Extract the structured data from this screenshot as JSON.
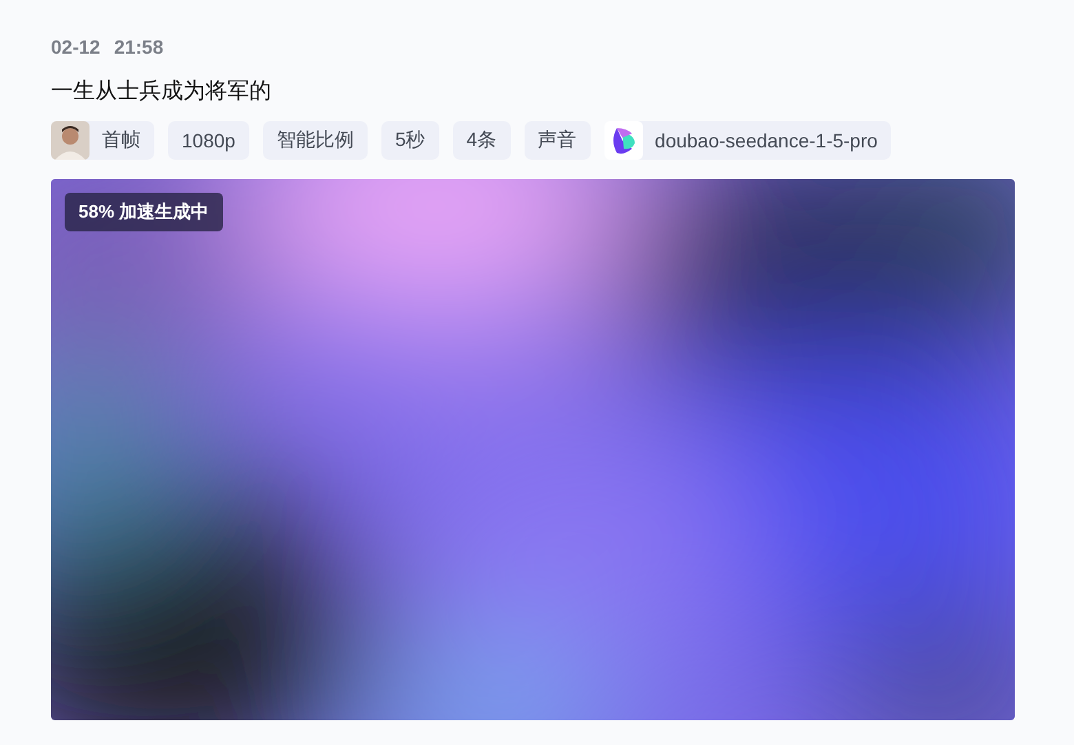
{
  "date": "02-12",
  "time": "21:58",
  "prompt": "一生从士兵成为将军的",
  "tags": [
    {
      "kind": "avatar",
      "label": "首帧"
    },
    {
      "kind": "plain",
      "label": "1080p"
    },
    {
      "kind": "plain",
      "label": "智能比例"
    },
    {
      "kind": "plain",
      "label": "5秒"
    },
    {
      "kind": "plain",
      "label": "4条"
    },
    {
      "kind": "plain",
      "label": "声音"
    },
    {
      "kind": "model",
      "label": "doubao-seedance-1-5-pro"
    }
  ],
  "preview": {
    "kind": "picture",
    "status": "58% 加速生成中"
  }
}
